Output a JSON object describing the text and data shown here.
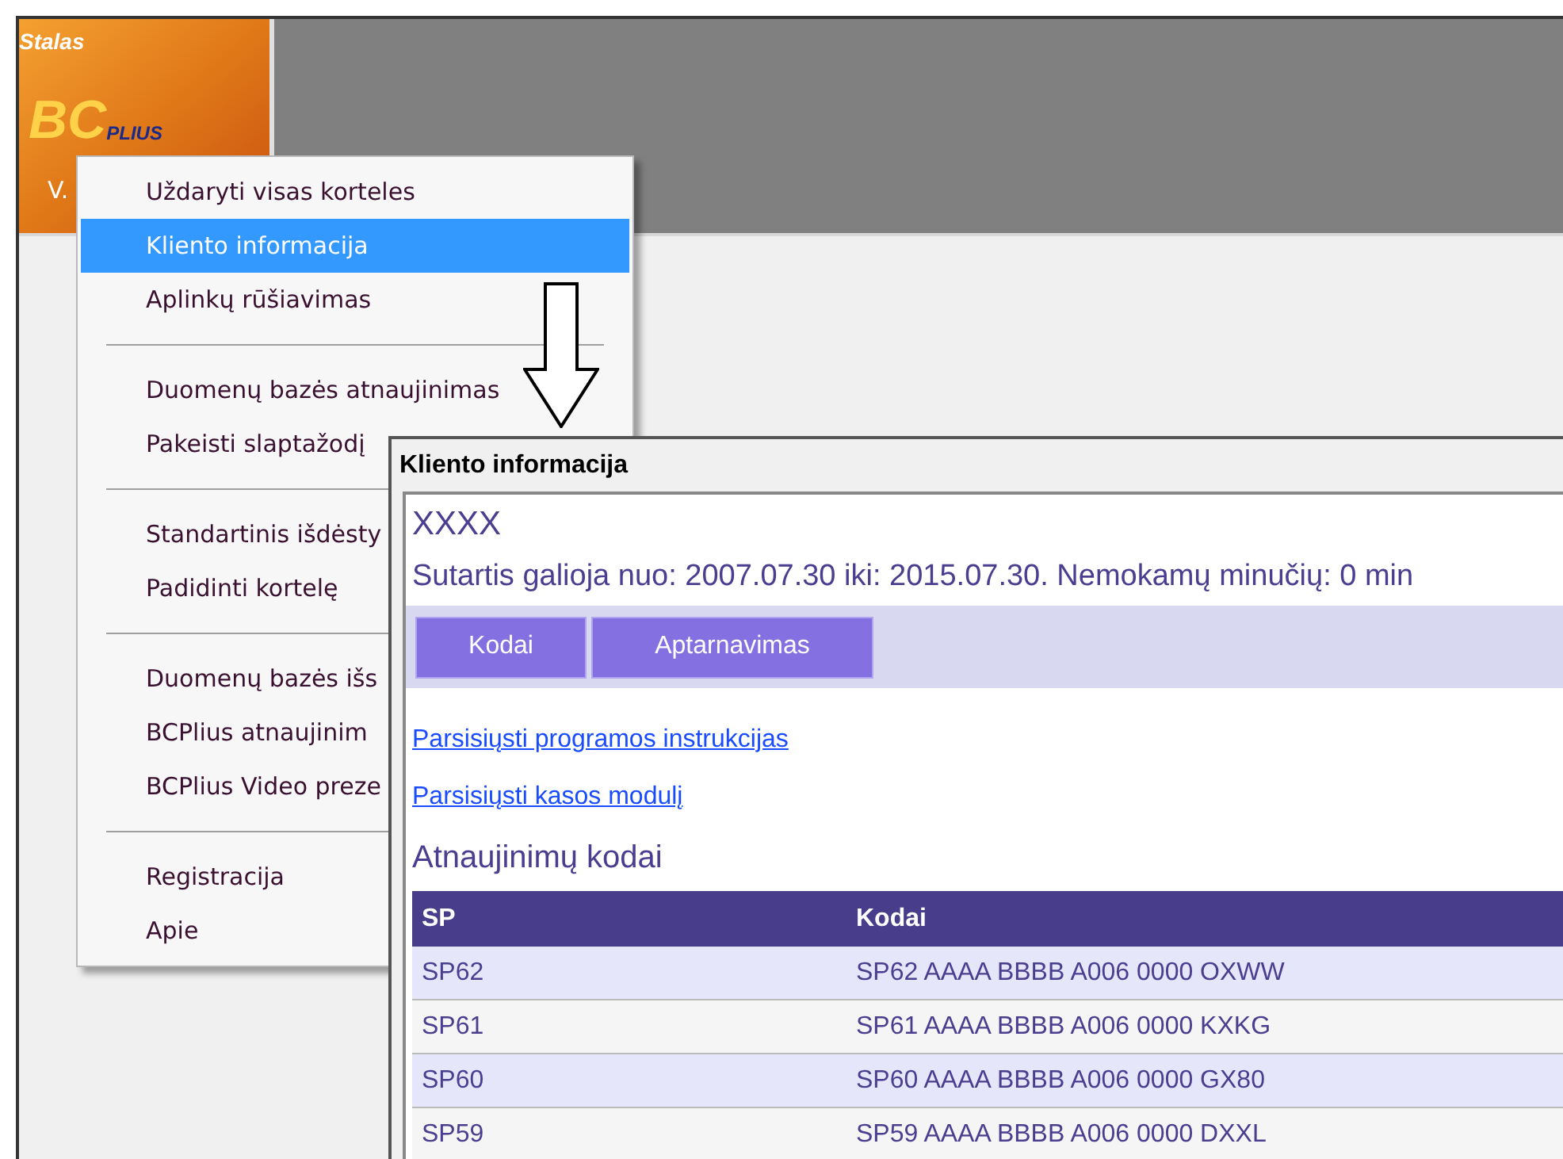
{
  "app": {
    "caption": "Stalas",
    "logo": {
      "main": "BC",
      "sub": "PLIUS"
    },
    "version": "V."
  },
  "context_menu": {
    "groups": [
      [
        {
          "label": "Uždaryti visas korteles",
          "selected": false
        },
        {
          "label": "Kliento informacija",
          "selected": true
        },
        {
          "label": "Aplinkų rūšiavimas",
          "selected": false
        }
      ],
      [
        {
          "label": "Duomenų bazės atnaujinimas",
          "selected": false
        },
        {
          "label": "Pakeisti slaptažodį",
          "selected": false
        }
      ],
      [
        {
          "label": "Standartinis išdėsty",
          "selected": false
        },
        {
          "label": "Padidinti kortelę",
          "selected": false
        }
      ],
      [
        {
          "label": "Duomenų bazės išs",
          "selected": false
        },
        {
          "label": "BCPlius atnaujinim",
          "selected": false
        },
        {
          "label": "BCPlius Video preze",
          "selected": false
        }
      ],
      [
        {
          "label": "Registracija",
          "selected": false
        },
        {
          "label": "Apie",
          "selected": false
        }
      ]
    ]
  },
  "dialog": {
    "title": "Kliento informacija",
    "client_name": "XXXX",
    "contract": "Sutartis galioja nuo: 2007.07.30 iki: 2015.07.30. Nemokamų minučių: 0 min",
    "tabs": [
      "Kodai",
      "Aptarnavimas"
    ],
    "links": [
      "Parsisiųsti programos instrukcijas",
      "Parsisiųsti kasos modulį"
    ],
    "section_title": "Atnaujinimų kodai",
    "table": {
      "columns": [
        "SP",
        "Kodai"
      ],
      "rows": [
        [
          "SP62",
          "SP62 AAAA BBBB A006 0000 OXWW"
        ],
        [
          "SP61",
          "SP61 AAAA BBBB A006 0000 KXKG"
        ],
        [
          "SP60",
          "SP60 AAAA BBBB A006 0000 GX80"
        ],
        [
          "SP59",
          "SP59 AAAA BBBB A006 0000 DXXL"
        ]
      ]
    }
  }
}
